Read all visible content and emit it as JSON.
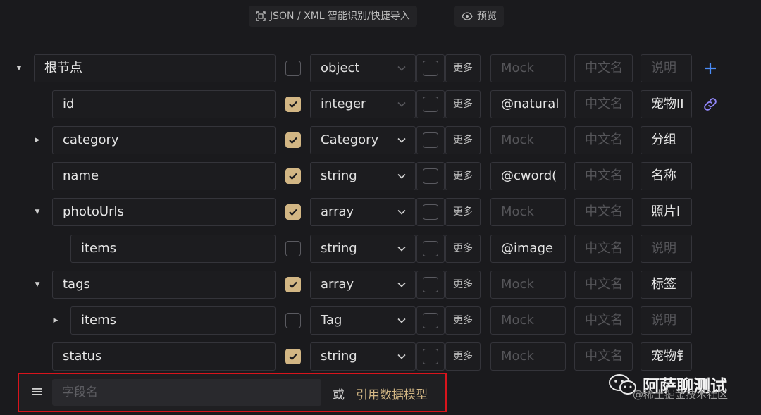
{
  "toolbar": {
    "import_label": "JSON / XML 智能识别/快捷导入",
    "preview_label": "预览"
  },
  "placeholders": {
    "mock": "Mock",
    "cn_name": "中文名",
    "desc": "说明"
  },
  "more_label": "更多",
  "rows": [
    {
      "name": "根节点",
      "caret": "down",
      "required": false,
      "type": "object",
      "type_dim": true,
      "mock": "",
      "cn": "",
      "desc": "",
      "side": "plus"
    },
    {
      "name": "id",
      "caret": "",
      "required": true,
      "type": "integer",
      "type_dim": true,
      "mock": "@natural",
      "cn": "",
      "desc": "宠物II",
      "side": "link"
    },
    {
      "name": "category",
      "caret": "right",
      "required": true,
      "type": "Category",
      "type_dim": false,
      "mock": "",
      "cn": "",
      "desc": "分组",
      "side": ""
    },
    {
      "name": "name",
      "caret": "",
      "required": true,
      "type": "string",
      "type_dim": false,
      "mock": "@cword(",
      "cn": "",
      "desc": "名称",
      "side": ""
    },
    {
      "name": "photoUrls",
      "caret": "down",
      "required": true,
      "type": "array",
      "type_dim": false,
      "mock": "",
      "cn": "",
      "desc": "照片l",
      "side": ""
    },
    {
      "name": "items",
      "caret": "",
      "required": false,
      "type": "string",
      "type_dim": false,
      "mock": "@image",
      "cn": "",
      "desc": "",
      "side": ""
    },
    {
      "name": "tags",
      "caret": "down",
      "required": true,
      "type": "array",
      "type_dim": false,
      "mock": "",
      "cn": "",
      "desc": "标签",
      "side": ""
    },
    {
      "name": "items",
      "caret": "right",
      "required": false,
      "type": "Tag",
      "type_dim": false,
      "mock": "",
      "cn": "",
      "desc": "",
      "side": ""
    },
    {
      "name": "status",
      "caret": "",
      "required": true,
      "type": "string",
      "type_dim": false,
      "mock": "",
      "cn": "",
      "desc": "宠物钅",
      "side": ""
    }
  ],
  "bottom": {
    "field_placeholder": "字段名",
    "or_label": "或",
    "ref_label": "引用数据模型"
  },
  "watermark": {
    "title": "阿萨聊测试",
    "subtitle": "@稀土掘金技术社区"
  },
  "icons": {
    "import": "scan-icon",
    "preview": "eye-icon",
    "add": "plus-icon",
    "link": "link-icon",
    "menu": "hamburger-icon",
    "caret_down": "caret-down-icon",
    "caret_right": "caret-right-icon",
    "chevron": "chevron-down-icon",
    "check": "check-icon",
    "wechat": "wechat-icon"
  },
  "colors": {
    "accent": "#d2b684",
    "plus": "#4a8cf7",
    "link": "#8f84f5",
    "highlight": "#d8141c",
    "bg": "#1a1a1d"
  }
}
